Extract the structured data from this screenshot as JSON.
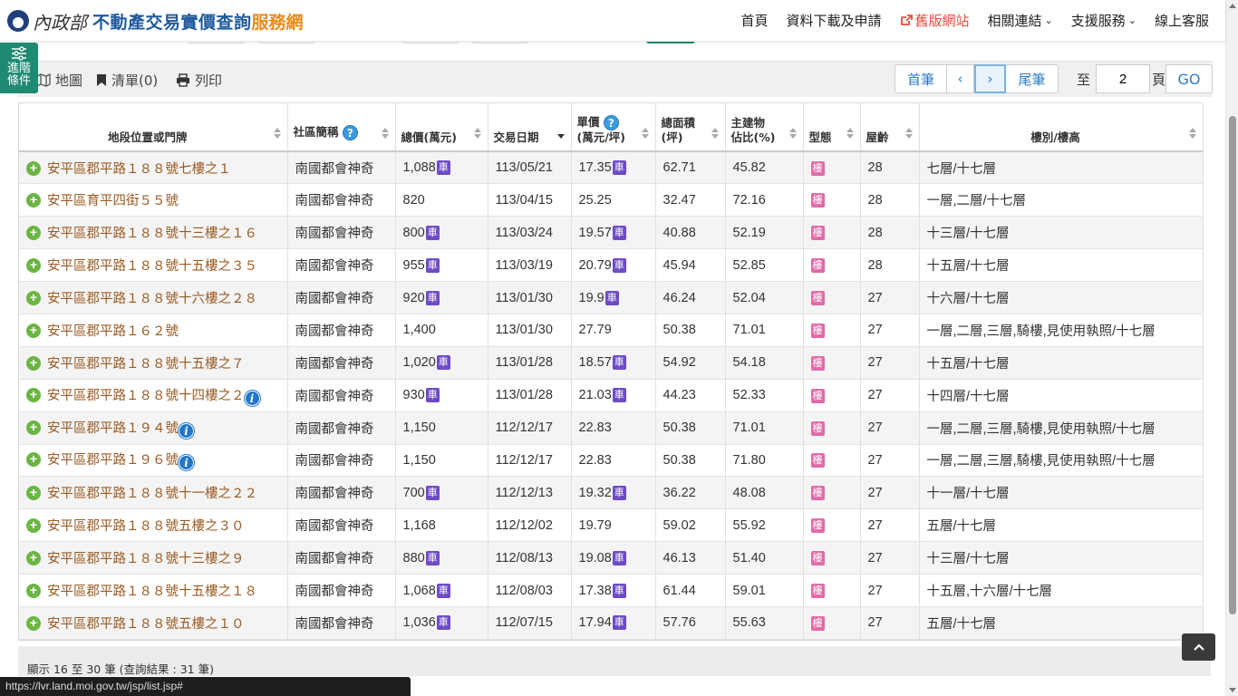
{
  "header": {
    "ministry": "內政部",
    "title_main": "不動產交易實價查詢",
    "title_accent": "服務網",
    "nav": {
      "home": "首頁",
      "downloads": "資料下載及申請",
      "old_site": "舊版網站",
      "links": "相關連結",
      "support": "支援服務",
      "service": "線上客服"
    }
  },
  "adv_tab": {
    "line1": "進階",
    "line2": "條件"
  },
  "toolbar": {
    "map": "地圖",
    "list": "清單(0)",
    "print": "列印"
  },
  "pager": {
    "first": "首筆",
    "prev": "‹",
    "next": "›",
    "last": "尾筆",
    "to": "至",
    "page_value": "2",
    "unit": "頁",
    "go": "GO"
  },
  "table": {
    "headers": {
      "address": "地段位置或門牌",
      "community": "社區簡稱",
      "total": "總價(萬元)",
      "date": "交易日期",
      "unit_l1": "單價",
      "unit_l2": "(萬元/坪)",
      "area_l1": "總面積",
      "area_l2": "(坪)",
      "main_l1": "主建物",
      "main_l2": "佔比(%)",
      "type": "型態",
      "age": "屋齡",
      "floor": "樓別/樓高"
    },
    "car_label": "車",
    "type_label": "樓",
    "rows": [
      {
        "address": "安平區郡平路１８８號七樓之１",
        "info": false,
        "community": "南國都會神奇",
        "total": "1,088",
        "total_car": true,
        "date": "113/05/21",
        "unit": "17.35",
        "unit_car": true,
        "area": "62.71",
        "main": "45.82",
        "age": "28",
        "floor": "七層/十七層"
      },
      {
        "address": "安平區育平四街５５號",
        "info": false,
        "community": "南國都會神奇",
        "total": "820",
        "total_car": false,
        "date": "113/04/15",
        "unit": "25.25",
        "unit_car": false,
        "area": "32.47",
        "main": "72.16",
        "age": "28",
        "floor": "一層,二層/十七層"
      },
      {
        "address": "安平區郡平路１８８號十三樓之１６",
        "info": false,
        "community": "南國都會神奇",
        "total": "800",
        "total_car": true,
        "date": "113/03/24",
        "unit": "19.57",
        "unit_car": true,
        "area": "40.88",
        "main": "52.19",
        "age": "28",
        "floor": "十三層/十七層"
      },
      {
        "address": "安平區郡平路１８８號十五樓之３５",
        "info": false,
        "community": "南國都會神奇",
        "total": "955",
        "total_car": true,
        "date": "113/03/19",
        "unit": "20.79",
        "unit_car": true,
        "area": "45.94",
        "main": "52.85",
        "age": "28",
        "floor": "十五層/十七層"
      },
      {
        "address": "安平區郡平路１８８號十六樓之２８",
        "info": false,
        "community": "南國都會神奇",
        "total": "920",
        "total_car": true,
        "date": "113/01/30",
        "unit": "19.9",
        "unit_car": true,
        "area": "46.24",
        "main": "52.04",
        "age": "27",
        "floor": "十六層/十七層"
      },
      {
        "address": "安平區郡平路１６２號",
        "info": false,
        "community": "南國都會神奇",
        "total": "1,400",
        "total_car": false,
        "date": "113/01/30",
        "unit": "27.79",
        "unit_car": false,
        "area": "50.38",
        "main": "71.01",
        "age": "27",
        "floor": "一層,二層,三層,騎樓,見使用執照/十七層"
      },
      {
        "address": "安平區郡平路１８８號十五樓之７",
        "info": false,
        "community": "南國都會神奇",
        "total": "1,020",
        "total_car": true,
        "date": "113/01/28",
        "unit": "18.57",
        "unit_car": true,
        "area": "54.92",
        "main": "54.18",
        "age": "27",
        "floor": "十五層/十七層"
      },
      {
        "address": "安平區郡平路１８８號十四樓之２",
        "info": true,
        "community": "南國都會神奇",
        "total": "930",
        "total_car": true,
        "date": "113/01/28",
        "unit": "21.03",
        "unit_car": true,
        "area": "44.23",
        "main": "52.33",
        "age": "27",
        "floor": "十四層/十七層"
      },
      {
        "address": "安平區郡平路１９４號",
        "info": true,
        "community": "南國都會神奇",
        "total": "1,150",
        "total_car": false,
        "date": "112/12/17",
        "unit": "22.83",
        "unit_car": false,
        "area": "50.38",
        "main": "71.01",
        "age": "27",
        "floor": "一層,二層,三層,騎樓,見使用執照/十七層"
      },
      {
        "address": "安平區郡平路１９６號",
        "info": true,
        "community": "南國都會神奇",
        "total": "1,150",
        "total_car": false,
        "date": "112/12/17",
        "unit": "22.83",
        "unit_car": false,
        "area": "50.38",
        "main": "71.80",
        "age": "27",
        "floor": "一層,二層,三層,騎樓,見使用執照/十七層"
      },
      {
        "address": "安平區郡平路１８８號十一樓之２２",
        "info": false,
        "community": "南國都會神奇",
        "total": "700",
        "total_car": true,
        "date": "112/12/13",
        "unit": "19.32",
        "unit_car": true,
        "area": "36.22",
        "main": "48.08",
        "age": "27",
        "floor": "十一層/十七層"
      },
      {
        "address": "安平區郡平路１８８號五樓之３０",
        "info": false,
        "community": "南國都會神奇",
        "total": "1,168",
        "total_car": false,
        "date": "112/12/02",
        "unit": "19.79",
        "unit_car": false,
        "area": "59.02",
        "main": "55.92",
        "age": "27",
        "floor": "五層/十七層"
      },
      {
        "address": "安平區郡平路１８８號十三樓之９",
        "info": false,
        "community": "南國都會神奇",
        "total": "880",
        "total_car": true,
        "date": "112/08/13",
        "unit": "19.08",
        "unit_car": true,
        "area": "46.13",
        "main": "51.40",
        "age": "27",
        "floor": "十三層/十七層"
      },
      {
        "address": "安平區郡平路１８８號十五樓之１８",
        "info": false,
        "community": "南國都會神奇",
        "total": "1,068",
        "total_car": true,
        "date": "112/08/03",
        "unit": "17.38",
        "unit_car": true,
        "area": "61.44",
        "main": "59.01",
        "age": "27",
        "floor": "十五層,十六層/十七層"
      },
      {
        "address": "安平區郡平路１８８號五樓之１０",
        "info": false,
        "community": "南國都會神奇",
        "total": "1,036",
        "total_car": true,
        "date": "112/07/15",
        "unit": "17.94",
        "unit_car": true,
        "area": "57.76",
        "main": "55.63",
        "age": "27",
        "floor": "五層/十七層"
      }
    ]
  },
  "footer": {
    "summary": "顯示 16 至 30 筆 (查詢結果 : 31 筆)"
  },
  "status_url": "https://lvr.land.moi.gov.tw/jsp/list.jsp#",
  "colors": {
    "accent_teal": "#1f8a72",
    "link_blue": "#2a7dc4",
    "address_brown": "#9a5a22",
    "car_purple": "#6e4bc5",
    "type_pink": "#e26aa8"
  }
}
